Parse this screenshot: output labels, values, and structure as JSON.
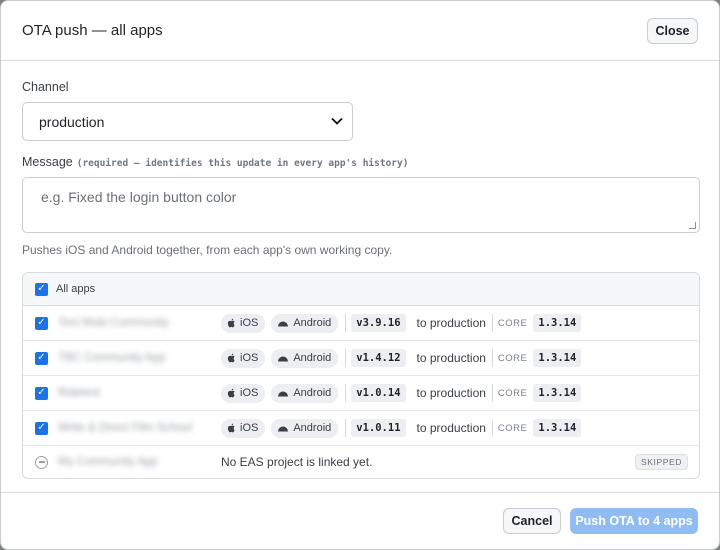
{
  "dialog": {
    "title": "OTA push — all apps",
    "close_label": "Close"
  },
  "channel": {
    "label": "Channel",
    "value": "production"
  },
  "message": {
    "label": "Message",
    "hint": "(required — identifies this update in every app's history)",
    "placeholder": "e.g. Fixed the login button color",
    "helper": "Pushes iOS and Android together, from each app's own working copy."
  },
  "apps": {
    "all_label": "All apps",
    "rows": [
      {
        "name": "Toni Mobi Community",
        "ios": "iOS",
        "android": "Android",
        "version": "v3.9.16",
        "target": "to production",
        "core_label": "CORE",
        "core_version": "1.3.14"
      },
      {
        "name": "TBC Community App",
        "ios": "iOS",
        "android": "Android",
        "version": "v1.4.12",
        "target": "to production",
        "core_label": "CORE",
        "core_version": "1.3.14"
      },
      {
        "name": "Ridetest",
        "ios": "iOS",
        "android": "Android",
        "version": "v1.0.14",
        "target": "to production",
        "core_label": "CORE",
        "core_version": "1.3.14"
      },
      {
        "name": "Write & Direct Film School",
        "ios": "iOS",
        "android": "Android",
        "version": "v1.0.11",
        "target": "to production",
        "core_label": "CORE",
        "core_version": "1.3.14"
      }
    ],
    "skipped": {
      "name": "My Community App",
      "message": "No EAS project is linked yet.",
      "badge": "SKIPPED"
    }
  },
  "footer": {
    "cancel_label": "Cancel",
    "push_label": "Push OTA to 4 apps"
  }
}
